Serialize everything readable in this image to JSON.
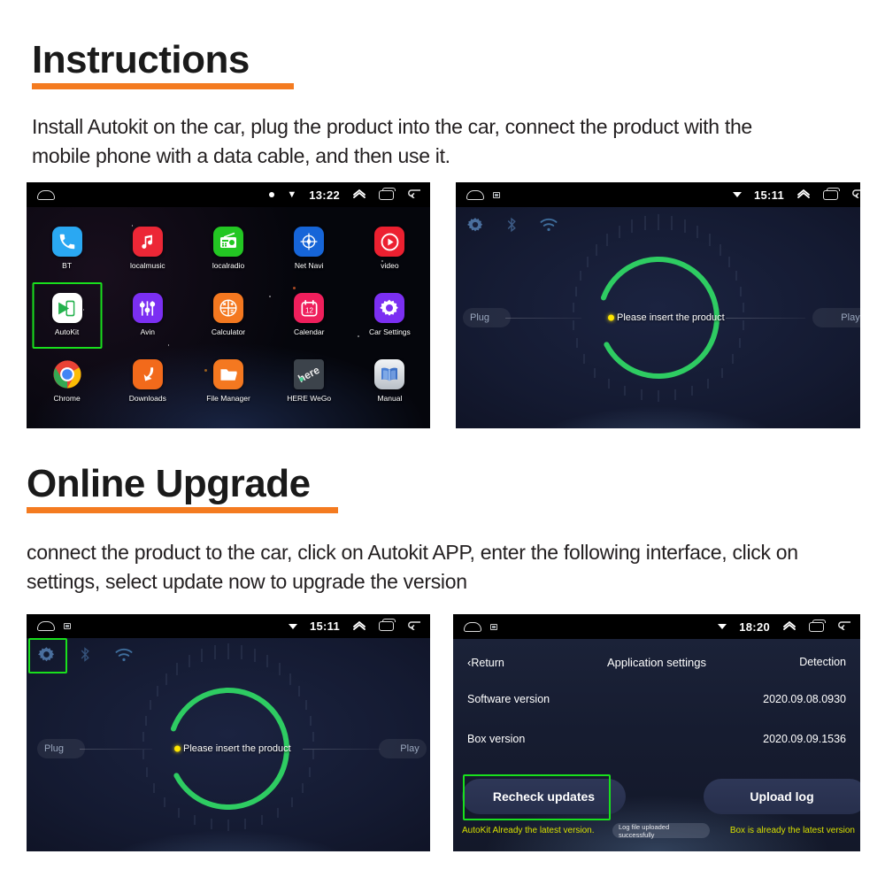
{
  "sections": [
    {
      "heading": "Instructions",
      "body": "Install Autokit on the car, plug the product into the car, connect the product with the mobile phone with a data cable, and then use it."
    },
    {
      "heading": "Online Upgrade",
      "body": "connect the product to the car, click on Autokit APP, enter the following interface, click on settings, select update now to upgrade the version"
    }
  ],
  "colors": {
    "accent": "#f47b20",
    "highlight": "#19e01d",
    "heading_text": "#1a1a1a",
    "note_yellow": "#d8e000",
    "ring_green": "#2ecc62",
    "dot_yellow": "#ffe600"
  },
  "panel_launcher": {
    "status_bar": {
      "time": "13:22",
      "icons_left": [
        "home-icon"
      ],
      "icons_right": [
        "dot-icon",
        "volume-icon",
        "chevron-up-icon",
        "recent-apps-icon",
        "back-icon"
      ]
    },
    "apps": [
      [
        {
          "label": "BT",
          "icon": "phone-icon",
          "color": "#2aa8f2"
        },
        {
          "label": "localmusic",
          "icon": "music-note-icon",
          "color": "#ec2736"
        },
        {
          "label": "localradio",
          "icon": "radio-icon",
          "color": "#23c723"
        },
        {
          "label": "Net Navi",
          "icon": "compass-icon",
          "color": "#1665d8"
        },
        {
          "label": "video",
          "icon": "play-circle-icon",
          "color": "#ec2030"
        }
      ],
      [
        {
          "label": "AutoKit",
          "icon": "autokit-icon",
          "color": "#ffffff",
          "selected": true
        },
        {
          "label": "Avin",
          "icon": "sliders-icon",
          "color": "#7b2ff2"
        },
        {
          "label": "Calculator",
          "icon": "calculator-icon",
          "color": "#f47820"
        },
        {
          "label": "Calendar",
          "icon": "calendar-icon",
          "color": "#ef1f5c"
        },
        {
          "label": "Car Settings",
          "icon": "gear-icon",
          "color": "#7b2ff2"
        }
      ],
      [
        {
          "label": "Chrome",
          "icon": "chrome-icon",
          "color": "#ffffff"
        },
        {
          "label": "Downloads",
          "icon": "download-arrow-icon",
          "color": "#f26a1b"
        },
        {
          "label": "File Manager",
          "icon": "folder-icon",
          "color": "#f47820"
        },
        {
          "label": "HERE WeGo",
          "icon": "here-wego-icon",
          "color": "#3c434b"
        },
        {
          "label": "Manual",
          "icon": "book-icon",
          "color": "#c9cfd6"
        }
      ]
    ]
  },
  "panel_waiting_top": {
    "status_bar": {
      "time": "15:11",
      "icons_left": [
        "home-icon",
        "screenshot-icon"
      ],
      "icons_right": [
        "caret-down-icon",
        "chevron-up-icon",
        "recent-apps-icon",
        "back-icon"
      ]
    },
    "toolbar_icons": [
      "gear-icon",
      "bluetooth-icon",
      "wifi-icon"
    ],
    "message": "Please insert the product",
    "left_pill": "Plug",
    "right_pill": "Play"
  },
  "panel_waiting_bottom": {
    "status_bar": {
      "time": "15:11",
      "icons_left": [
        "home-icon",
        "screenshot-icon"
      ],
      "icons_right": [
        "caret-down-icon",
        "chevron-up-icon",
        "recent-apps-icon",
        "back-icon"
      ]
    },
    "toolbar_icons": [
      "gear-icon",
      "bluetooth-icon",
      "wifi-icon"
    ],
    "highlighted_icon": "gear-icon",
    "message": "Please insert the product",
    "left_pill": "Plug",
    "right_pill": "Play"
  },
  "panel_settings": {
    "status_bar": {
      "time": "18:20",
      "icons_left": [
        "home-icon",
        "screenshot-icon"
      ],
      "icons_right": [
        "caret-down-icon",
        "chevron-up-icon",
        "recent-apps-icon",
        "back-icon"
      ]
    },
    "header": {
      "back_label": "Return",
      "title": "Application settings",
      "action_label": "Detection"
    },
    "rows": [
      {
        "label": "Software version",
        "value": "2020.09.08.0930"
      },
      {
        "label": "Box version",
        "value": "2020.09.09.1536"
      }
    ],
    "buttons": {
      "recheck": "Recheck updates",
      "upload": "Upload log"
    },
    "highlighted_button": "recheck-updates-button",
    "notes": {
      "left": "AutoKit Already the latest version.",
      "toast": "Log file uploaded successfully",
      "right": "Box is already the latest version"
    }
  }
}
